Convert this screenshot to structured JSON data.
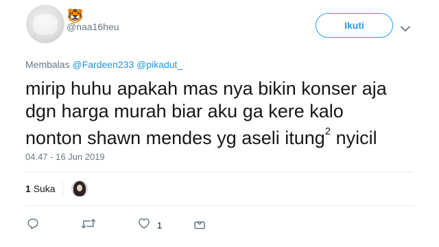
{
  "user": {
    "display_name": "🐯",
    "handle": "@naa16heu"
  },
  "follow_button": {
    "label": "Ikuti"
  },
  "reply": {
    "prefix": "Membalas",
    "mentions": [
      "@Fardeen233",
      "@pikadut_"
    ]
  },
  "tweet": {
    "line1": "mirip huhu apakah mas nya bikin konser aja",
    "line2": "dgn harga murah biar aku ga kere kalo",
    "line3_main": "nonton shawn mendes yg aseli itung",
    "line3_sup": "2",
    "line3_end": " nyicil"
  },
  "timestamp": "04.47 - 16 Jun 2019",
  "engagement": {
    "like_count": "1",
    "like_label": "Suka"
  },
  "actions": {
    "reply_icon": "reply-icon",
    "retweet_icon": "retweet-icon",
    "like_icon": "heart-icon",
    "like_count": "1",
    "share_icon": "share-icon"
  },
  "colors": {
    "accent": "#1da1f2",
    "mention": "#1b95e0",
    "secondary_text": "#657786",
    "icon": "#657786"
  }
}
